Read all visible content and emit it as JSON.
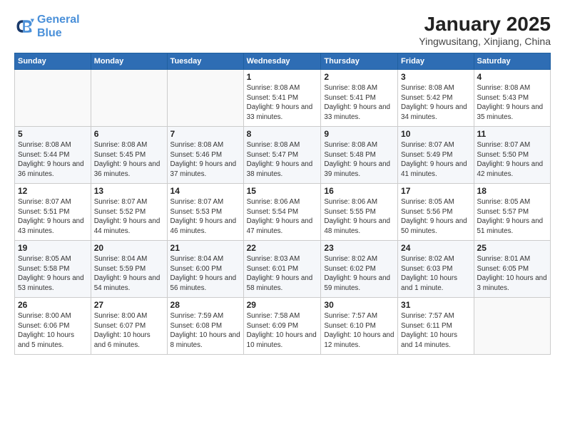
{
  "header": {
    "logo_line1": "General",
    "logo_line2": "Blue",
    "title": "January 2025",
    "subtitle": "Yingwusitang, Xinjiang, China"
  },
  "weekdays": [
    "Sunday",
    "Monday",
    "Tuesday",
    "Wednesday",
    "Thursday",
    "Friday",
    "Saturday"
  ],
  "weeks": [
    [
      {
        "day": "",
        "info": ""
      },
      {
        "day": "",
        "info": ""
      },
      {
        "day": "",
        "info": ""
      },
      {
        "day": "1",
        "info": "Sunrise: 8:08 AM\nSunset: 5:41 PM\nDaylight: 9 hours and 33 minutes."
      },
      {
        "day": "2",
        "info": "Sunrise: 8:08 AM\nSunset: 5:41 PM\nDaylight: 9 hours and 33 minutes."
      },
      {
        "day": "3",
        "info": "Sunrise: 8:08 AM\nSunset: 5:42 PM\nDaylight: 9 hours and 34 minutes."
      },
      {
        "day": "4",
        "info": "Sunrise: 8:08 AM\nSunset: 5:43 PM\nDaylight: 9 hours and 35 minutes."
      }
    ],
    [
      {
        "day": "5",
        "info": "Sunrise: 8:08 AM\nSunset: 5:44 PM\nDaylight: 9 hours and 36 minutes."
      },
      {
        "day": "6",
        "info": "Sunrise: 8:08 AM\nSunset: 5:45 PM\nDaylight: 9 hours and 36 minutes."
      },
      {
        "day": "7",
        "info": "Sunrise: 8:08 AM\nSunset: 5:46 PM\nDaylight: 9 hours and 37 minutes."
      },
      {
        "day": "8",
        "info": "Sunrise: 8:08 AM\nSunset: 5:47 PM\nDaylight: 9 hours and 38 minutes."
      },
      {
        "day": "9",
        "info": "Sunrise: 8:08 AM\nSunset: 5:48 PM\nDaylight: 9 hours and 39 minutes."
      },
      {
        "day": "10",
        "info": "Sunrise: 8:07 AM\nSunset: 5:49 PM\nDaylight: 9 hours and 41 minutes."
      },
      {
        "day": "11",
        "info": "Sunrise: 8:07 AM\nSunset: 5:50 PM\nDaylight: 9 hours and 42 minutes."
      }
    ],
    [
      {
        "day": "12",
        "info": "Sunrise: 8:07 AM\nSunset: 5:51 PM\nDaylight: 9 hours and 43 minutes."
      },
      {
        "day": "13",
        "info": "Sunrise: 8:07 AM\nSunset: 5:52 PM\nDaylight: 9 hours and 44 minutes."
      },
      {
        "day": "14",
        "info": "Sunrise: 8:07 AM\nSunset: 5:53 PM\nDaylight: 9 hours and 46 minutes."
      },
      {
        "day": "15",
        "info": "Sunrise: 8:06 AM\nSunset: 5:54 PM\nDaylight: 9 hours and 47 minutes."
      },
      {
        "day": "16",
        "info": "Sunrise: 8:06 AM\nSunset: 5:55 PM\nDaylight: 9 hours and 48 minutes."
      },
      {
        "day": "17",
        "info": "Sunrise: 8:05 AM\nSunset: 5:56 PM\nDaylight: 9 hours and 50 minutes."
      },
      {
        "day": "18",
        "info": "Sunrise: 8:05 AM\nSunset: 5:57 PM\nDaylight: 9 hours and 51 minutes."
      }
    ],
    [
      {
        "day": "19",
        "info": "Sunrise: 8:05 AM\nSunset: 5:58 PM\nDaylight: 9 hours and 53 minutes."
      },
      {
        "day": "20",
        "info": "Sunrise: 8:04 AM\nSunset: 5:59 PM\nDaylight: 9 hours and 54 minutes."
      },
      {
        "day": "21",
        "info": "Sunrise: 8:04 AM\nSunset: 6:00 PM\nDaylight: 9 hours and 56 minutes."
      },
      {
        "day": "22",
        "info": "Sunrise: 8:03 AM\nSunset: 6:01 PM\nDaylight: 9 hours and 58 minutes."
      },
      {
        "day": "23",
        "info": "Sunrise: 8:02 AM\nSunset: 6:02 PM\nDaylight: 9 hours and 59 minutes."
      },
      {
        "day": "24",
        "info": "Sunrise: 8:02 AM\nSunset: 6:03 PM\nDaylight: 10 hours and 1 minute."
      },
      {
        "day": "25",
        "info": "Sunrise: 8:01 AM\nSunset: 6:05 PM\nDaylight: 10 hours and 3 minutes."
      }
    ],
    [
      {
        "day": "26",
        "info": "Sunrise: 8:00 AM\nSunset: 6:06 PM\nDaylight: 10 hours and 5 minutes."
      },
      {
        "day": "27",
        "info": "Sunrise: 8:00 AM\nSunset: 6:07 PM\nDaylight: 10 hours and 6 minutes."
      },
      {
        "day": "28",
        "info": "Sunrise: 7:59 AM\nSunset: 6:08 PM\nDaylight: 10 hours and 8 minutes."
      },
      {
        "day": "29",
        "info": "Sunrise: 7:58 AM\nSunset: 6:09 PM\nDaylight: 10 hours and 10 minutes."
      },
      {
        "day": "30",
        "info": "Sunrise: 7:57 AM\nSunset: 6:10 PM\nDaylight: 10 hours and 12 minutes."
      },
      {
        "day": "31",
        "info": "Sunrise: 7:57 AM\nSunset: 6:11 PM\nDaylight: 10 hours and 14 minutes."
      },
      {
        "day": "",
        "info": ""
      }
    ]
  ]
}
